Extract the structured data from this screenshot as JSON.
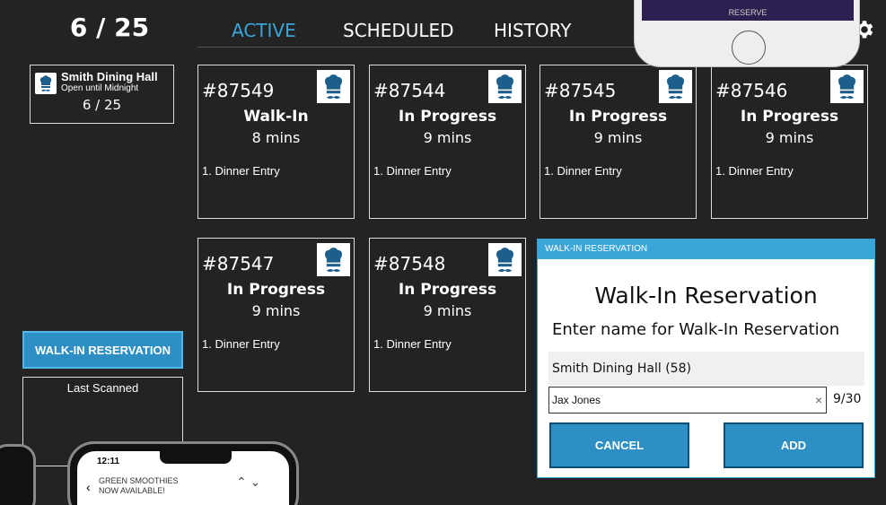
{
  "header": {
    "count": "6 / 25",
    "tabs": [
      {
        "label": "ACTIVE",
        "active": true
      },
      {
        "label": "SCHEDULED",
        "active": false
      },
      {
        "label": "HISTORY",
        "active": false
      }
    ],
    "settings_icon": "gear-icon"
  },
  "sidebar": {
    "hall": {
      "name": "Smith Dining Hall",
      "subtitle": "Open until Midnight",
      "count": "6 / 25",
      "icon": "chef-icon"
    },
    "walkin_button": "WALK-IN RESERVATION",
    "last_scanned_label": "Last Scanned"
  },
  "orders": [
    {
      "number": "#87549",
      "status": "Walk-In",
      "time": "8 mins",
      "entry": "1. Dinner Entry"
    },
    {
      "number": "#87544",
      "status": "In Progress",
      "time": "9 mins",
      "entry": "1. Dinner Entry"
    },
    {
      "number": "#87545",
      "status": "In Progress",
      "time": "9 mins",
      "entry": "1. Dinner Entry"
    },
    {
      "number": "#87546",
      "status": "In Progress",
      "time": "9 mins",
      "entry": "1. Dinner Entry"
    },
    {
      "number": "#87547",
      "status": "In Progress",
      "time": "9 mins",
      "entry": "1. Dinner Entry"
    },
    {
      "number": "#87548",
      "status": "In Progress",
      "time": "9 mins",
      "entry": "1. Dinner Entry"
    }
  ],
  "dialog": {
    "titlebar": "WALK-IN RESERVATION",
    "heading": "Walk-In Reservation",
    "prompt": "Enter name for Walk-In Reservation",
    "location": "Smith Dining Hall (58)",
    "name_value": "Jax Jones",
    "char_count": "9/30",
    "clear_symbol": "×",
    "cancel_label": "CANCEL",
    "add_label": "ADD"
  },
  "phones": {
    "top_button": "RESERVE",
    "bottom_time": "12:11",
    "bottom_message_line1": "GREEN SMOOTHIES",
    "bottom_message_line2": "NOW AVAILABLE!"
  },
  "colors": {
    "background": "#232323",
    "accent": "#3aa6d8",
    "button": "#2d8fc4"
  }
}
